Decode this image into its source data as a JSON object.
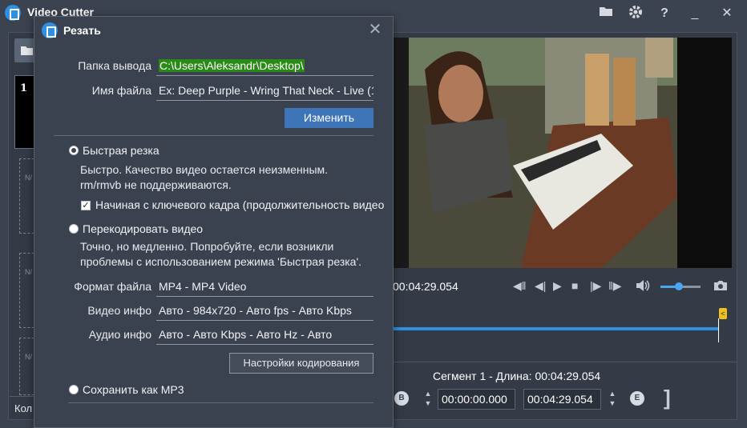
{
  "app": {
    "title": "Video Cutter"
  },
  "titlebar": {
    "icons": [
      "folder-icon",
      "gear-icon",
      "help-icon",
      "minimize-icon",
      "close-icon"
    ],
    "help_glyph": "?",
    "minimize_glyph": "_",
    "close_glyph": "✕"
  },
  "sidebar": {
    "thumb_number": "1",
    "slot_text": "N/",
    "bottom_label": "Кол"
  },
  "player": {
    "current_time": "00:04:29.054",
    "controls": [
      "prev-segment-icon",
      "prev-frame-icon",
      "play-icon",
      "stop-icon",
      "next-frame-icon",
      "next-segment-icon",
      "volume-icon",
      "camera-icon"
    ],
    "volume_level": 0.45,
    "marker_glyph": "<"
  },
  "segment": {
    "label": "Сегмент 1 - Длина: 00:04:29.054",
    "start": "00:00:00.000",
    "end": "00:04:29.054",
    "start_btn": "B",
    "end_btn": "E",
    "bracket": "]"
  },
  "dialog": {
    "title": "Резать",
    "close_glyph": "✕",
    "output_folder_label": "Папка вывода",
    "output_folder_value": "C:\\Users\\Aleksandr\\Desktop\\",
    "file_name_label": "Имя файла",
    "file_name_value": "Ex: Deep Purple - Wring That Neck - Live (1",
    "change_button": "Изменить",
    "fast_cut_label": "Быстрая резка",
    "fast_cut_desc": "Быстро. Качество видео остается неизменным. rm/rmvb не поддерживаются.",
    "keyframe_label": "Начиная с ключевого кадра (продолжительность видео",
    "keyframe_checked": true,
    "reencode_label": "Перекодировать видео",
    "reencode_desc": "Точно, но медленно. Попробуйте, если возникли проблемы с использованием режима 'Быстрая резка'.",
    "format_label": "Формат файла",
    "format_value": "MP4 - MP4 Video",
    "video_info_label": "Видео инфо",
    "video_info_value": "Авто - 984x720 - Авто fps - Авто Kbps",
    "audio_info_label": "Аудио инфо",
    "audio_info_value": "Авто - Авто Kbps - Авто Hz - Авто",
    "encode_settings_button": "Настройки кодирования",
    "save_mp3_label": "Сохранить как MP3",
    "selected_mode": "fast_cut"
  },
  "colors": {
    "accent": "#2f8fe0",
    "button_blue": "#3e74b8",
    "folder_highlight": "#2a8a18",
    "dialog_bg": "#3b424f",
    "window_bg": "#3c4350"
  }
}
